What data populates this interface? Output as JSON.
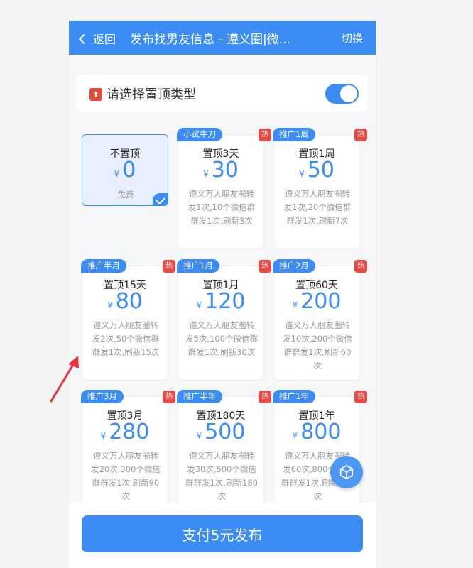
{
  "header": {
    "back_label": "返回",
    "title": "发布找男友信息 - 遵义圈|微...",
    "switch_label": "切换",
    "bg_color": "#3b8cf3"
  },
  "type_section": {
    "icon": "upload-arrow-icon",
    "label": "请选择置顶类型",
    "toggle_on": true
  },
  "plans": [
    {
      "tag": "",
      "hot": false,
      "name": "不置顶",
      "currency": "¥",
      "price": "0",
      "desc": "免费",
      "selected": true
    },
    {
      "tag": "小试牛刀",
      "hot": true,
      "hot_label": "热",
      "name": "置顶3天",
      "currency": "¥",
      "price": "30",
      "desc": "遵义万人朋友圈转发1次,10个微信群群发1次,刷新3次",
      "selected": false
    },
    {
      "tag": "推广1周",
      "hot": true,
      "hot_label": "热",
      "name": "置顶1周",
      "currency": "¥",
      "price": "50",
      "desc": "遵义万人朋友圈转发1次,20个微信群群发1次,刷新7次",
      "selected": false
    },
    {
      "tag": "推广半月",
      "hot": true,
      "hot_label": "热",
      "name": "置顶15天",
      "currency": "¥",
      "price": "80",
      "desc": "遵义万人朋友圈转发2次,50个微信群群发1次,刷新15次",
      "selected": false
    },
    {
      "tag": "推广1月",
      "hot": true,
      "hot_label": "热",
      "name": "置顶1月",
      "currency": "¥",
      "price": "120",
      "desc": "遵义万人朋友圈转发5次,100个微信群群发1次,刷新30次",
      "selected": false
    },
    {
      "tag": "推广2月",
      "hot": true,
      "hot_label": "热",
      "name": "置顶60天",
      "currency": "¥",
      "price": "200",
      "desc": "遵义万人朋友圈转发10次,200个微信群群发1次,刷新60次",
      "selected": false
    },
    {
      "tag": "推广3月",
      "hot": true,
      "hot_label": "热",
      "name": "置顶3月",
      "currency": "¥",
      "price": "280",
      "desc": "遵义万人朋友圈转发20次,300个微信群群发1次,刷新90次",
      "selected": false
    },
    {
      "tag": "推广半年",
      "hot": true,
      "hot_label": "热",
      "name": "置顶180天",
      "currency": "¥",
      "price": "500",
      "desc": "遵义万人朋友圈转发30次,500个微信群群发1次,刷新180次",
      "selected": false
    },
    {
      "tag": "推广1年",
      "hot": true,
      "hot_label": "热",
      "name": "置顶1年",
      "currency": "¥",
      "price": "800",
      "desc": "遵义万人朋友圈转发60次,800个微信群群发1次,刷新365次",
      "selected": false
    }
  ],
  "floating_button": {
    "icon": "cube-icon"
  },
  "footer": {
    "pay_label": "支付5元发布"
  },
  "annotation": {
    "icon": "red-pointer-arrow-icon",
    "color": "#e8323f"
  }
}
